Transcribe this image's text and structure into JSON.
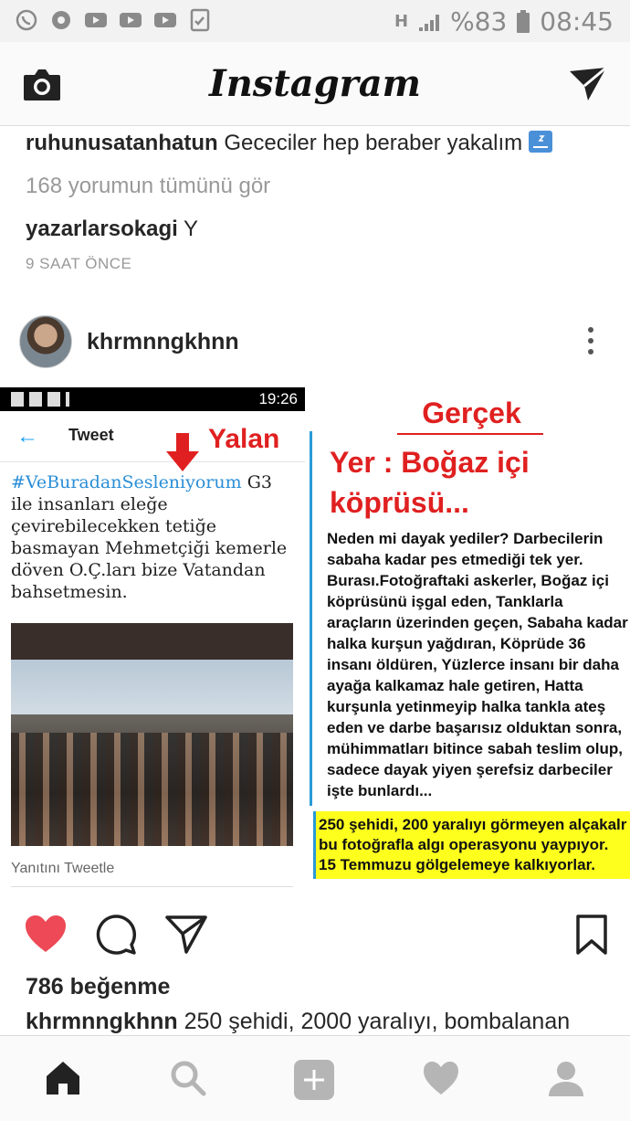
{
  "status_bar": {
    "network": "H",
    "battery": "%83",
    "time": "08:45"
  },
  "app": {
    "title": "Instagram"
  },
  "previous_post": {
    "caption_user": "ruhunusatanhatun",
    "caption_text": "Gececiler hep beraber yakalım",
    "view_comments": "168 yorumun tümünü gör",
    "comment_user": "yazarlarsokagi",
    "comment_text": "Y",
    "time_ago": "9 SAAT ÖNCE"
  },
  "post": {
    "username": "khrmnngkhnn",
    "likes": "786 beğenme",
    "caption_user": "khrmnngkhnn",
    "caption_text": "250 şehidi, 2000 yaralıyı, bombalanan"
  },
  "post_image": {
    "left": {
      "status_time": "19:26",
      "tweet_title": "Tweet",
      "yalan": "Yalan",
      "hashtag": "#VeBuradanSesleniyorum",
      "tweet_text": "G3 ile insanları eleğe çevirebilecekken tetiğe basmayan Mehmetçiği kemerle döven O.Ç.ları bize Vatandan bahsetmesin.",
      "reply": "Yanıtını Tweetle"
    },
    "right": {
      "heading": "Gerçek",
      "headline": "Yer : Boğaz içi köprüsü...",
      "body": "Neden mi dayak yediler? Darbecilerin sabaha kadar pes etmediği tek yer. Burası.Fotoğraftaki askerler, Boğaz içi köprüsünü işgal eden, Tanklarla araçların üzerinden geçen, Sabaha kadar halka kurşun yağdıran, Köprüde 36 insanı öldüren, Yüzlerce insanı bir daha ayağa kalkamaz hale getiren, Hatta kurşunla yetinmeyip halka tankla ateş eden ve darbe başarısız olduktan sonra, mühimmatları bitince sabah teslim olup, sadece dayak yiyen şerefsiz darbeciler işte bunlardı...",
      "highlight": "250 şehidi, 200 yaralıyı görmeyen alçakalr bu fotoğrafla algı operasyonu yaypıyor. 15 Temmuzu gölgelemeye kalkıyorlar."
    }
  },
  "colors": {
    "like_red": "#ed4956",
    "accent_red": "#e02020",
    "twitter_blue": "#1da1f2",
    "highlight_yellow": "#ffff1e"
  },
  "icons": [
    "camera-icon",
    "direct-send-icon",
    "heart-icon",
    "comment-icon",
    "share-icon",
    "bookmark-icon",
    "home-icon",
    "search-icon",
    "add-icon",
    "activity-icon",
    "profile-icon",
    "more-icon"
  ]
}
